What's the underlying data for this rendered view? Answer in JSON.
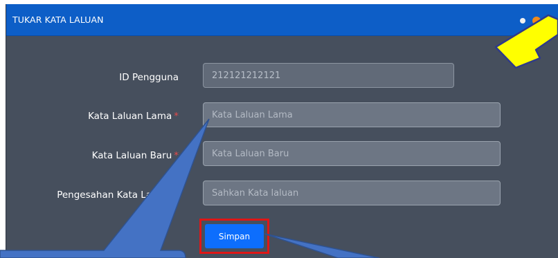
{
  "dialog": {
    "title": "TUKAR KATA LALUAN"
  },
  "form": {
    "user_id": {
      "label": "ID Pengguna",
      "value": "212121212121"
    },
    "old_password": {
      "label": "Kata Laluan Lama",
      "required_mark": "*",
      "placeholder": "Kata Laluan Lama"
    },
    "new_password": {
      "label": "Kata Laluan Baru",
      "required_mark": "*",
      "placeholder": "Kata Laluan Baru"
    },
    "confirm_password": {
      "label": "Pengesahan Kata Laluan",
      "required_mark": "*",
      "placeholder": "Sahkan Kata laluan"
    },
    "save_label": "Simpan"
  },
  "colors": {
    "titlebar": "#0d5ec7",
    "dialog_bg": "#464f5d",
    "save_button": "#0d6efd",
    "highlight_box": "#e01616",
    "callout": "#4472c4",
    "arrow": "#ffff00"
  }
}
